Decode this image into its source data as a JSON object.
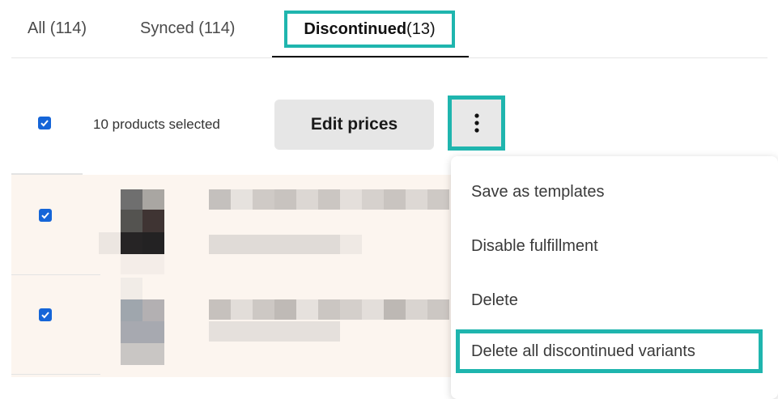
{
  "tabs": {
    "all": "All (114)",
    "synced": "Synced (114)",
    "discontinued_label": "Discontinued",
    "discontinued_count": " (13)"
  },
  "toolbar": {
    "selected_text": "10 products selected",
    "edit_prices_label": "Edit prices",
    "more_icon": "vertical-ellipsis-icon"
  },
  "menu": {
    "items": [
      "Save as templates",
      "Disable fulfillment",
      "Delete",
      "Delete all discontinued variants"
    ]
  },
  "colors": {
    "highlight": "#1fb5ae",
    "checkbox": "#1565d8",
    "row_background": "#fcf5ef"
  }
}
